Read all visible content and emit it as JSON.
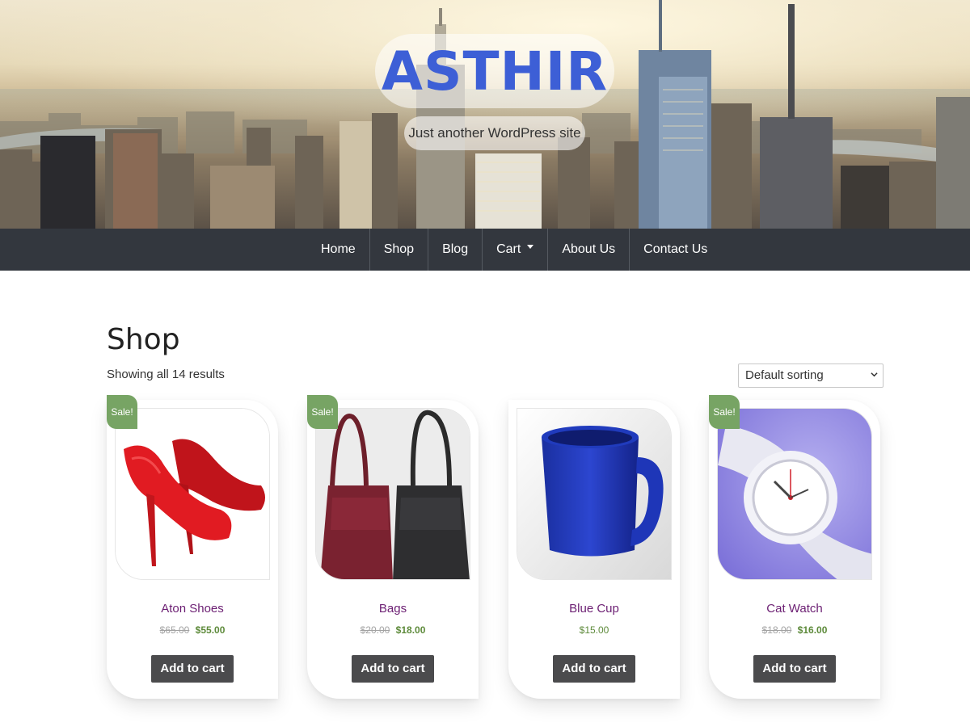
{
  "site": {
    "title": "ASTHIR",
    "tagline": "Just another WordPress site",
    "title_color": "#3d5fd6"
  },
  "nav": {
    "items": [
      {
        "label": "Home"
      },
      {
        "label": "Shop"
      },
      {
        "label": "Blog"
      },
      {
        "label": "Cart",
        "has_dropdown": true
      },
      {
        "label": "About Us"
      },
      {
        "label": "Contact Us"
      }
    ],
    "background": "#33373e"
  },
  "shop": {
    "title": "Shop",
    "result_count": "Showing all 14 results",
    "sort": {
      "selected": "Default sorting"
    }
  },
  "products": [
    {
      "name": "Aton Shoes",
      "on_sale": true,
      "sale_label": "Sale!",
      "old_price": "$65.00",
      "price": "$55.00",
      "button": "Add to cart",
      "image": "red-high-heels"
    },
    {
      "name": "Bags",
      "on_sale": true,
      "sale_label": "Sale!",
      "old_price": "$20.00",
      "price": "$18.00",
      "button": "Add to cart",
      "image": "leather-bags"
    },
    {
      "name": "Blue Cup",
      "on_sale": false,
      "price": "$15.00",
      "button": "Add to cart",
      "image": "blue-mug"
    },
    {
      "name": "Cat Watch",
      "on_sale": true,
      "sale_label": "Sale!",
      "old_price": "$18.00",
      "price": "$16.00",
      "button": "Add to cart",
      "image": "white-wristwatch"
    }
  ],
  "colors": {
    "sale_badge": "#77a464",
    "product_title": "#6b1e72",
    "price": "#5d8a3a",
    "button": "#4b4b4d"
  }
}
